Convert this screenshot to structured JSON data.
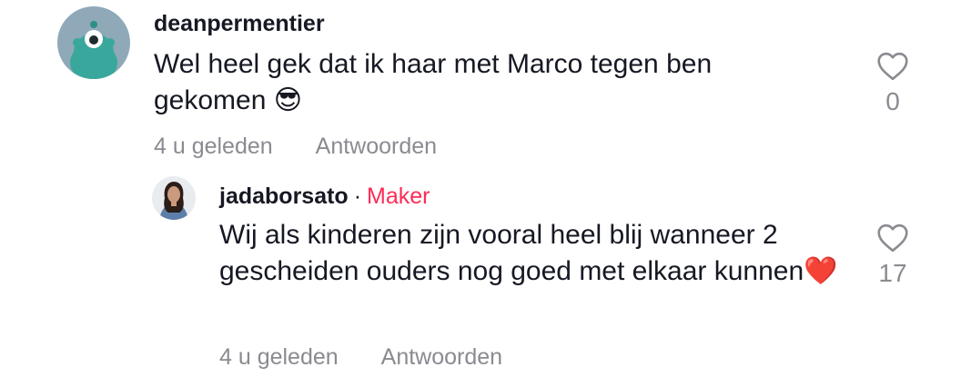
{
  "comments": [
    {
      "username": "deanpermentier",
      "text": "Wel heel gek dat ik haar met Marco tegen ben gekomen 😎",
      "time": "4 u geleden",
      "reply_label": "Antwoorden",
      "likes": "0",
      "avatar_icon": "teal-monster-avatar",
      "avatar_bg": "#8fa9b8"
    }
  ],
  "reply": {
    "username": "jadaborsato",
    "separator": "·",
    "badge": "Maker",
    "text": "Wij als kinderen zijn vooral heel blij wanneer 2 gescheiden ouders nog goed met elkaar kunnen❤️",
    "time": "4 u geleden",
    "reply_label": "Antwoorden",
    "likes": "17",
    "avatar_icon": "profile-photo-avatar"
  },
  "colors": {
    "text": "#161823",
    "muted": "#8a8b91",
    "maker": "#fe2c55",
    "heart_outline": "#8a8b91"
  },
  "icons": {
    "like": "heart-outline-icon"
  }
}
